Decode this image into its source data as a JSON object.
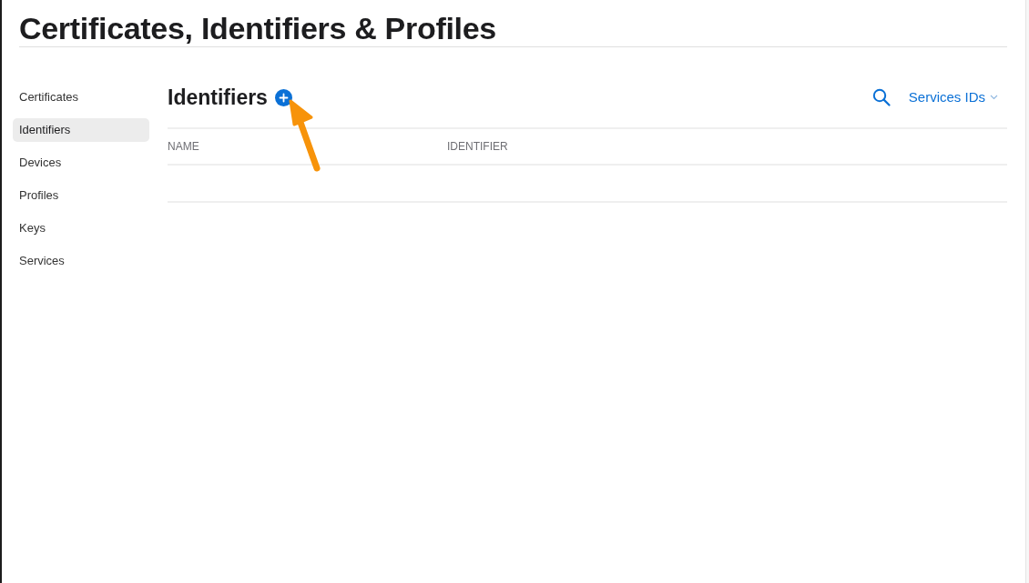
{
  "page_title": "Certificates, Identifiers & Profiles",
  "sidebar": {
    "items": [
      {
        "label": "Certificates",
        "selected": false
      },
      {
        "label": "Identifiers",
        "selected": true
      },
      {
        "label": "Devices",
        "selected": false
      },
      {
        "label": "Profiles",
        "selected": false
      },
      {
        "label": "Keys",
        "selected": false
      },
      {
        "label": "Services",
        "selected": false
      }
    ]
  },
  "section": {
    "title": "Identifiers",
    "filter": {
      "label": "Services IDs"
    }
  },
  "table": {
    "columns": [
      "NAME",
      "IDENTIFIER"
    ]
  }
}
